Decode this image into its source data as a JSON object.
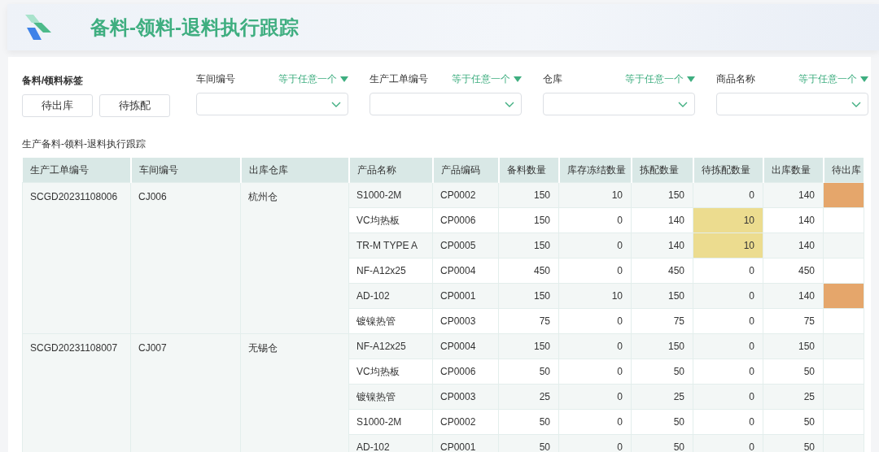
{
  "header": {
    "title": "备料-领料-退料执行跟踪"
  },
  "tag_filter": {
    "label": "备料/领料标签",
    "tags": [
      {
        "label": "待出库",
        "selected": false
      },
      {
        "label": "待拣配",
        "selected": false
      }
    ]
  },
  "filters": [
    {
      "label": "车间编号",
      "operator": "等于任意一个"
    },
    {
      "label": "生产工单编号",
      "operator": "等于任意一个"
    },
    {
      "label": "仓库",
      "operator": "等于任意一个"
    },
    {
      "label": "商品名称",
      "operator": "等于任意一个"
    }
  ],
  "table": {
    "title": "生产备料-领料-退料执行跟踪",
    "columns": [
      "生产工单编号",
      "车间编号",
      "出库仓库",
      "产品名称",
      "产品编码",
      "备料数量",
      "库存冻结数量",
      "拣配数量",
      "待拣配数量",
      "出库数量",
      "待出库"
    ],
    "groups": [
      {
        "order": "SCGD20231108006",
        "workshop": "CJ006",
        "warehouse": "杭州仓",
        "items": [
          {
            "name": "S1000-2M",
            "code": "CP0002",
            "prep": "150",
            "frozen": "10",
            "picked": "150",
            "to_pick": "0",
            "out": "140",
            "to_pick_alert": false,
            "to_out_alert": true
          },
          {
            "name": "VC均热板",
            "code": "CP0006",
            "prep": "150",
            "frozen": "0",
            "picked": "140",
            "to_pick": "10",
            "out": "140",
            "to_pick_alert": true,
            "to_out_alert": false
          },
          {
            "name": "TR-M TYPE A",
            "code": "CP0005",
            "prep": "150",
            "frozen": "0",
            "picked": "140",
            "to_pick": "10",
            "out": "140",
            "to_pick_alert": true,
            "to_out_alert": false
          },
          {
            "name": "NF-A12x25",
            "code": "CP0004",
            "prep": "450",
            "frozen": "0",
            "picked": "450",
            "to_pick": "0",
            "out": "450",
            "to_pick_alert": false,
            "to_out_alert": false
          },
          {
            "name": "AD-102",
            "code": "CP0001",
            "prep": "150",
            "frozen": "10",
            "picked": "150",
            "to_pick": "0",
            "out": "140",
            "to_pick_alert": false,
            "to_out_alert": true
          },
          {
            "name": "镀镍热管",
            "code": "CP0003",
            "prep": "75",
            "frozen": "0",
            "picked": "75",
            "to_pick": "0",
            "out": "75",
            "to_pick_alert": false,
            "to_out_alert": false
          }
        ]
      },
      {
        "order": "SCGD20231108007",
        "workshop": "CJ007",
        "warehouse": "无锡仓",
        "items": [
          {
            "name": "NF-A12x25",
            "code": "CP0004",
            "prep": "150",
            "frozen": "0",
            "picked": "150",
            "to_pick": "0",
            "out": "150",
            "to_pick_alert": false,
            "to_out_alert": false
          },
          {
            "name": "VC均热板",
            "code": "CP0006",
            "prep": "50",
            "frozen": "0",
            "picked": "50",
            "to_pick": "0",
            "out": "50",
            "to_pick_alert": false,
            "to_out_alert": false
          },
          {
            "name": "镀镍热管",
            "code": "CP0003",
            "prep": "25",
            "frozen": "0",
            "picked": "25",
            "to_pick": "0",
            "out": "25",
            "to_pick_alert": false,
            "to_out_alert": false
          },
          {
            "name": "S1000-2M",
            "code": "CP0002",
            "prep": "50",
            "frozen": "0",
            "picked": "50",
            "to_pick": "0",
            "out": "50",
            "to_pick_alert": false,
            "to_out_alert": false
          },
          {
            "name": "AD-102",
            "code": "CP0001",
            "prep": "50",
            "frozen": "0",
            "picked": "50",
            "to_pick": "0",
            "out": "50",
            "to_pick_alert": false,
            "to_out_alert": false
          }
        ]
      }
    ]
  }
}
